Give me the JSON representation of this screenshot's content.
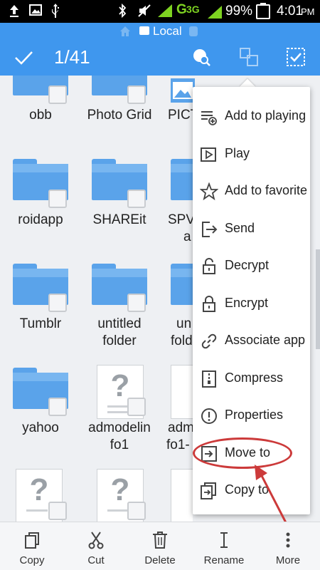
{
  "status_bar": {
    "net_type": "G",
    "net_type2": "3G",
    "battery": "99%",
    "time": "4:01",
    "ampm": "PM"
  },
  "location": {
    "label": "Local"
  },
  "action_bar": {
    "count": "1/41"
  },
  "files": [
    {
      "label": "obb",
      "type": "folder"
    },
    {
      "label": "Photo Grid",
      "type": "folder"
    },
    {
      "label": "PICT",
      "type": "image"
    },
    {
      "label": "roidapp",
      "type": "folder"
    },
    {
      "label": "SHAREit",
      "type": "folder"
    },
    {
      "label": "SPV",
      "label2": "a",
      "type": "folder"
    },
    {
      "label": "Tumblr",
      "type": "folder"
    },
    {
      "label": "untitled",
      "label2": "folder",
      "type": "folder"
    },
    {
      "label": "un",
      "label2": "fold",
      "type": "folder"
    },
    {
      "label": "yahoo",
      "type": "folder"
    },
    {
      "label": "admodelin",
      "label2": "fo1",
      "type": "unknown"
    },
    {
      "label": "adm",
      "label2": "fo1-",
      "type": "unknown"
    }
  ],
  "menu": {
    "items": [
      {
        "label": "Add to playing",
        "icon": "playlist-add-icon"
      },
      {
        "label": "Play",
        "icon": "play-icon"
      },
      {
        "label": "Add to favorite",
        "icon": "star-icon"
      },
      {
        "label": "Send",
        "icon": "send-icon"
      },
      {
        "label": "Decrypt",
        "icon": "unlock-icon"
      },
      {
        "label": "Encrypt",
        "icon": "lock-icon"
      },
      {
        "label": "Associate app",
        "icon": "link-icon"
      },
      {
        "label": "Compress",
        "icon": "compress-icon"
      },
      {
        "label": "Properties",
        "icon": "info-icon"
      },
      {
        "label": "Move to",
        "icon": "move-icon"
      },
      {
        "label": "Copy to",
        "icon": "copy-to-icon"
      }
    ]
  },
  "bottom_bar": {
    "copy": "Copy",
    "cut": "Cut",
    "delete": "Delete",
    "rename": "Rename",
    "more": "More"
  },
  "colors": {
    "accent": "#3f97ee",
    "folder": "#5aa3ea",
    "annotation": "#cc3a3a"
  }
}
